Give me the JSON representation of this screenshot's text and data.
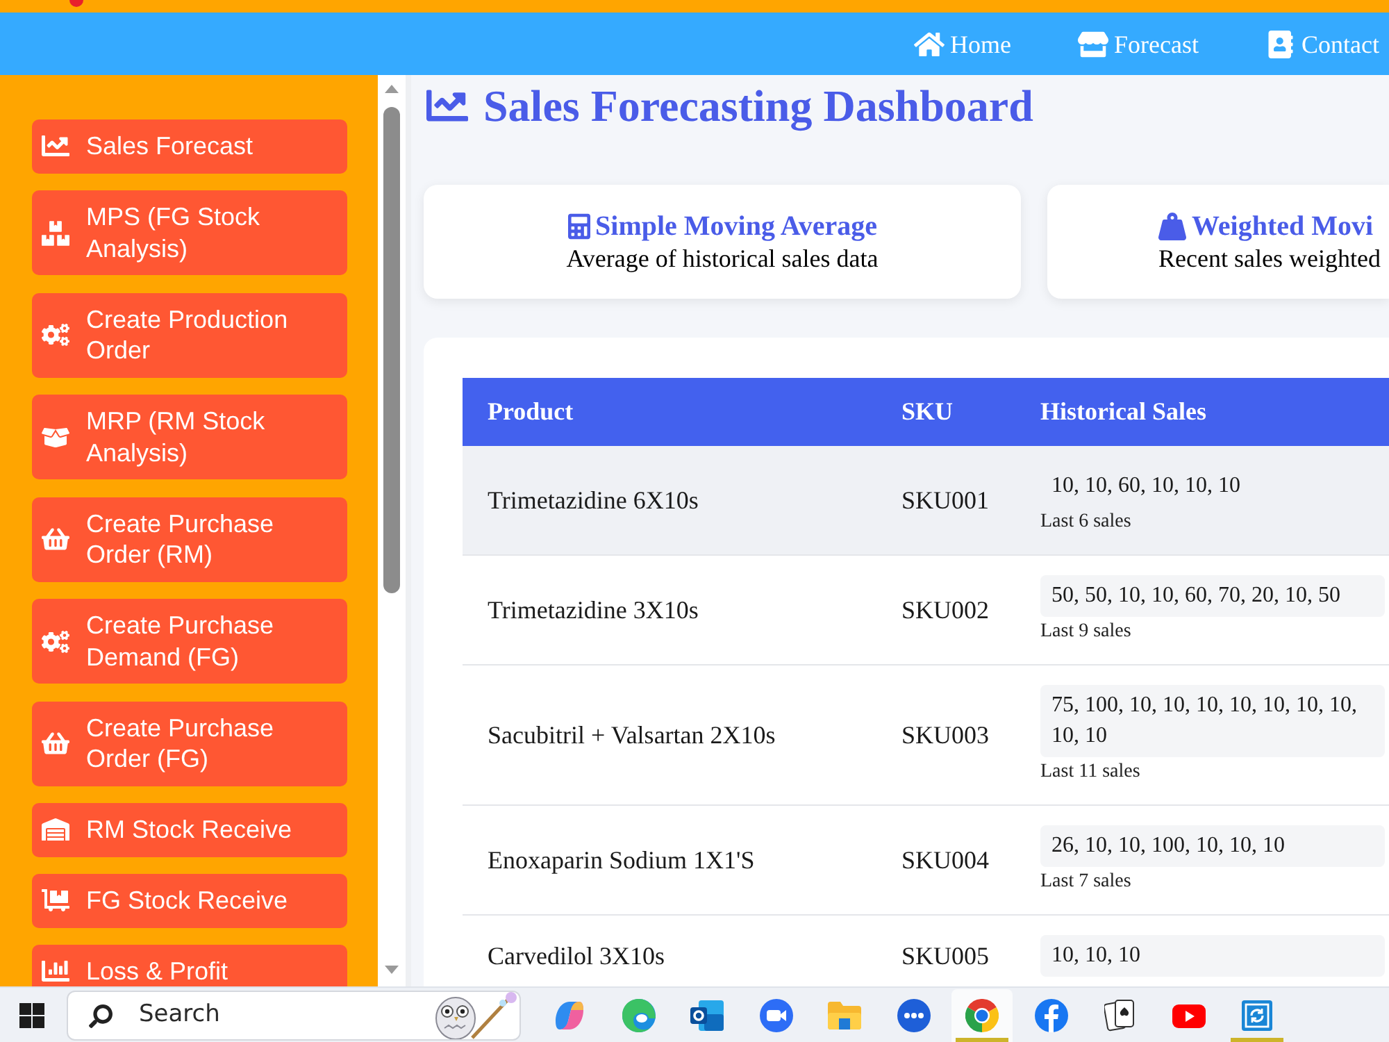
{
  "navbar": {
    "links": [
      {
        "label": "Home"
      },
      {
        "label": "Forecast"
      },
      {
        "label": "Contact"
      }
    ]
  },
  "sidebar": {
    "items": [
      {
        "label": "Sales Forecast"
      },
      {
        "label": "MPS (FG Stock Analysis)"
      },
      {
        "label": "Create Production Order"
      },
      {
        "label": "MRP (RM Stock Analysis)"
      },
      {
        "label": "Create Purchase Order (RM)"
      },
      {
        "label": "Create Purchase Demand (FG)"
      },
      {
        "label": "Create Purchase Order (FG)"
      },
      {
        "label": "RM Stock Receive"
      },
      {
        "label": "FG Stock Receive"
      },
      {
        "label": "Loss & Profit"
      }
    ]
  },
  "page": {
    "title": "Sales Forecasting Dashboard",
    "method_cards": [
      {
        "title": "Simple Moving Average",
        "description": "Average of historical sales data"
      },
      {
        "title": "Weighted Movi",
        "description": "Recent sales weighted"
      }
    ]
  },
  "table": {
    "columns": [
      "Product",
      "SKU",
      "Historical Sales"
    ],
    "rows": [
      {
        "product": "Trimetazidine 6X10s",
        "sku": "SKU001",
        "sales": "10, 10, 60, 10, 10, 10",
        "note": "Last 6 sales",
        "highlighted": true
      },
      {
        "product": "Trimetazidine 3X10s",
        "sku": "SKU002",
        "sales": "50, 50, 10, 10, 60, 70, 20, 10, 50",
        "note": "Last 9 sales",
        "highlighted": false
      },
      {
        "product": "Sacubitril + Valsartan 2X10s",
        "sku": "SKU003",
        "sales": "75, 100, 10, 10, 10, 10, 10, 10, 10, 10, 10",
        "note": "Last 11 sales",
        "highlighted": false
      },
      {
        "product": "Enoxaparin Sodium 1X1'S",
        "sku": "SKU004",
        "sales": "26, 10, 10, 100, 10, 10, 10",
        "note": "Last 7 sales",
        "highlighted": false
      },
      {
        "product": "Carvedilol 3X10s",
        "sku": "SKU005",
        "sales": "10, 10, 10",
        "highlighted": false
      }
    ]
  },
  "taskbar": {
    "search": {
      "placeholder": "Search"
    },
    "apps": [
      {
        "active": false,
        "running": false
      },
      {
        "active": false,
        "running": false
      },
      {
        "active": false,
        "running": false
      },
      {
        "active": false,
        "running": false
      },
      {
        "active": false,
        "running": false
      },
      {
        "active": false,
        "running": false
      },
      {
        "active": true,
        "running": true
      },
      {
        "active": false,
        "running": false
      },
      {
        "active": false,
        "running": false
      },
      {
        "active": false,
        "running": false
      },
      {
        "active": false,
        "running": true
      }
    ]
  }
}
